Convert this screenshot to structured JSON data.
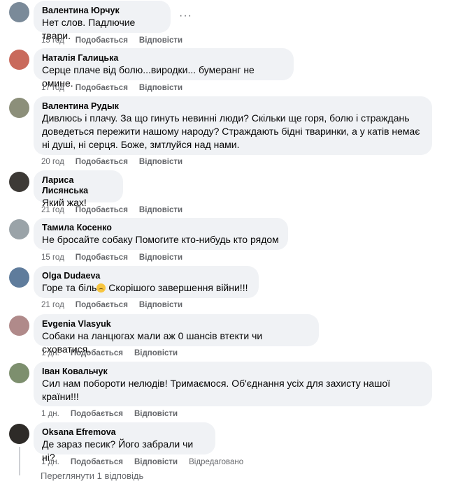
{
  "comments": [
    {
      "author": "Валентина Юрчук",
      "text": "Нет слов. Падлючие твари.",
      "time": "15 год",
      "like": "Подобається",
      "reply": "Відповісти",
      "avatar_color": "#7a8a99"
    },
    {
      "author": "Наталія Галицька",
      "text": "Серце плаче від болю...виродки... бумеранг не омине.",
      "time": "17 год",
      "like": "Подобається",
      "reply": "Відповісти",
      "avatar_color": "#c96a5c"
    },
    {
      "author": "Валентина Рудык",
      "text": "Дивлюсь і плачу. За що гинуть невинні люди? Скільки ще горя, болю і страждань доведеться пережити нашому народу? Страждають бідні тваринки, а у катів немає ні душі, ні серця. Боже, змтлуйся над нами.",
      "time": "20 год",
      "like": "Подобається",
      "reply": "Відповісти",
      "avatar_color": "#8c8f7a"
    },
    {
      "author": "Лариса Лисянська",
      "text": "Який жах!",
      "time": "21 год",
      "like": "Подобається",
      "reply": "Відповісти",
      "avatar_color": "#3d3a36"
    },
    {
      "author": "Тамила Косенко",
      "text": "Не бросайте собаку Помогите кто-нибудь кто рядом",
      "time": "15 год",
      "like": "Подобається",
      "reply": "Відповісти",
      "avatar_color": "#9aa3a8"
    },
    {
      "author": "Olga Dudaeva",
      "text_before": "Горе та біль",
      "text_after": " Скорішого завершення війни!!!",
      "time": "21 год",
      "like": "Подобається",
      "reply": "Відповісти",
      "avatar_color": "#5f7c9c"
    },
    {
      "author": "Evgenia Vlasyuk",
      "text": "Собаки на ланцюгах мали аж 0 шансів втекти чи сховатися.",
      "time": "1 дн.",
      "like": "Подобається",
      "reply": "Відповісти",
      "avatar_color": "#b08a8a"
    },
    {
      "author": "Іван Ковальчук",
      "text": "Сил нам побороти нелюдів! Тримаємося. Об'єднання усіх для захисту нашої країни!!!",
      "time": "1 дн.",
      "like": "Подобається",
      "reply": "Відповісти",
      "avatar_color": "#7d8f6e"
    },
    {
      "author": "Oksana Efremova",
      "text": "Де зараз песик? Його забрали чи ні?",
      "time": "1 дн.",
      "like": "Подобається",
      "reply": "Відповісти",
      "edited": "Відредаговано",
      "avatar_color": "#2e2b28"
    }
  ],
  "more_icon": "ellipsis-icon",
  "footer_partial": "Переглянути 1 відповідь"
}
